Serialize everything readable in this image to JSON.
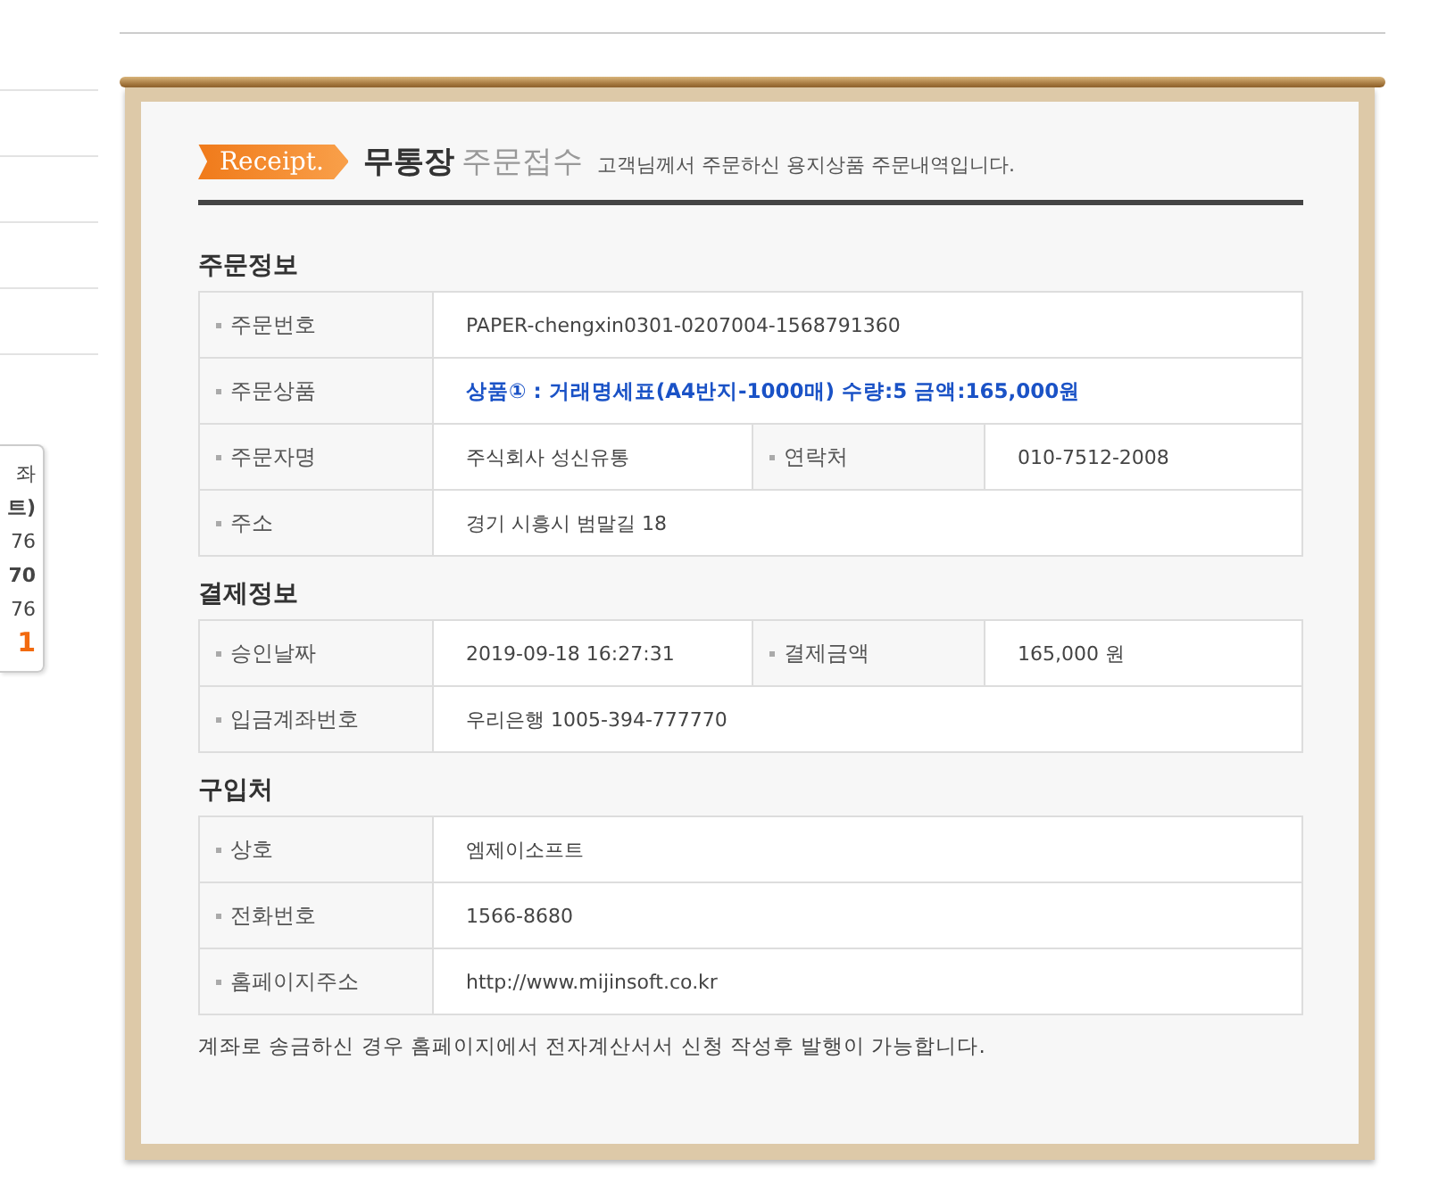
{
  "sidebar": {
    "fragments": [
      {
        "text": "좌",
        "kind": "label"
      },
      {
        "text": "트)",
        "kind": "bold"
      },
      {
        "text": "76",
        "kind": "number"
      },
      {
        "text": "70",
        "kind": "bold"
      },
      {
        "text": "76",
        "kind": "number"
      },
      {
        "text": "1",
        "kind": "accent"
      }
    ]
  },
  "receipt": {
    "badge": "Receipt.",
    "title_strong": "무통장",
    "title_light": "주문접수",
    "subtitle": "고객님께서 주문하신 용지상품 주문내역입니다.",
    "sections": [
      {
        "title": "주문정보",
        "rows": [
          [
            {
              "label": "주문번호",
              "value": "PAPER-chengxin0301-0207004-1568791360"
            }
          ],
          [
            {
              "label": "주문상품",
              "value": "상품① : 거래명세표(A4반지-1000매) 수량:5 금액:165,000원",
              "kind": "highlight"
            }
          ],
          [
            {
              "label": "주문자명",
              "value": "주식회사 성신유통"
            },
            {
              "label": "연락처",
              "value": "010-7512-2008"
            }
          ],
          [
            {
              "label": "주소",
              "value": "경기 시흥시 범말길 18"
            }
          ]
        ]
      },
      {
        "title": "결제정보",
        "rows": [
          [
            {
              "label": "승인날짜",
              "value": "2019-09-18 16:27:31"
            },
            {
              "label": "결제금액",
              "value": "165,000 원"
            }
          ],
          [
            {
              "label": "입금계좌번호",
              "value": "우리은행 1005-394-777770"
            }
          ]
        ]
      },
      {
        "title": "구입처",
        "rows": [
          [
            {
              "label": "상호",
              "value": "엠제이소프트"
            }
          ],
          [
            {
              "label": "전화번호",
              "value": "1566-8680"
            }
          ],
          [
            {
              "label": "홈페이지주소",
              "value": "http://www.mijinsoft.co.kr"
            }
          ]
        ]
      }
    ],
    "note": "계좌로 송금하신 경우 홈페이지에서 전자계산서서 신청 작성후 발행이 가능합니다."
  }
}
